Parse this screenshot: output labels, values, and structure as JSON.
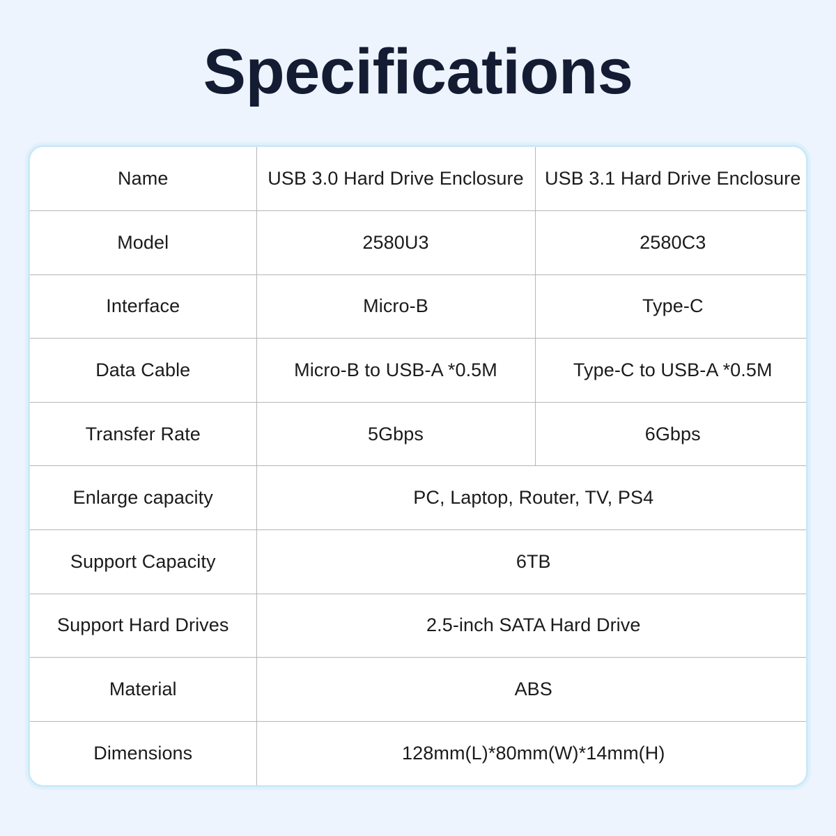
{
  "page": {
    "title": "Specifications",
    "background_color": "#eef4fd",
    "card_background_color": "#ffffff",
    "card_border_color": "#cbe9f9",
    "title_color": "#141c33",
    "text_color": "#1b1b1b",
    "divider_color": "#b6b6b6"
  },
  "table": {
    "rows": [
      {
        "label": "Name",
        "merged": false,
        "value_a": "USB 3.0 Hard Drive Enclosure",
        "value_b": "USB 3.1 Hard Drive Enclosure"
      },
      {
        "label": "Model",
        "merged": false,
        "value_a": "2580U3",
        "value_b": "2580C3"
      },
      {
        "label": "Interface",
        "merged": false,
        "value_a": "Micro-B",
        "value_b": "Type-C"
      },
      {
        "label": "Data Cable",
        "merged": false,
        "value_a": "Micro-B to USB-A *0.5M",
        "value_b": "Type-C to USB-A *0.5M"
      },
      {
        "label": "Transfer Rate",
        "merged": false,
        "value_a": "5Gbps",
        "value_b": "6Gbps"
      },
      {
        "label": "Enlarge capacity",
        "merged": true,
        "value": "PC, Laptop, Router, TV, PS4"
      },
      {
        "label": "Support Capacity",
        "merged": true,
        "value": "6TB"
      },
      {
        "label": "Support Hard Drives",
        "merged": true,
        "value": "2.5-inch SATA Hard Drive"
      },
      {
        "label": "Material",
        "merged": true,
        "value": "ABS"
      },
      {
        "label": "Dimensions",
        "merged": true,
        "value": "128mm(L)*80mm(W)*14mm(H)"
      }
    ]
  }
}
